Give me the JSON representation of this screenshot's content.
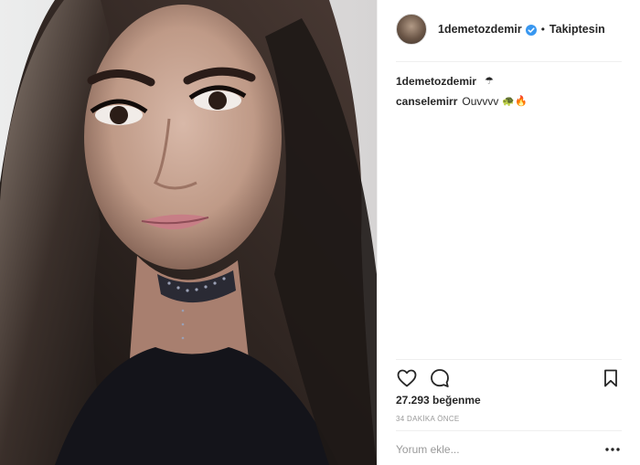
{
  "post": {
    "image_alt": "selfie photo"
  },
  "header": {
    "username": "1demetozdemir",
    "verified_icon": "verified-badge-icon",
    "separator": "•",
    "follow_status": "Takiptesin"
  },
  "comments": [
    {
      "user": "1demetozdemir",
      "text": "",
      "emoji": "☂"
    },
    {
      "user": "canselemirr",
      "text": "Ouvvvv",
      "emoji": "🐢🔥"
    }
  ],
  "actions": {
    "like_icon": "heart-icon",
    "comment_icon": "comment-bubble-icon",
    "save_icon": "bookmark-icon"
  },
  "likes": "27.293 beğenme",
  "timestamp": "34 DAKİKA ÖNCE",
  "comment_box": {
    "placeholder": "Yorum ekle...",
    "more_icon": "more-options-icon"
  },
  "colors": {
    "text": "#262626",
    "muted": "#999999",
    "divider": "#efefef",
    "verified": "#3897f0"
  }
}
